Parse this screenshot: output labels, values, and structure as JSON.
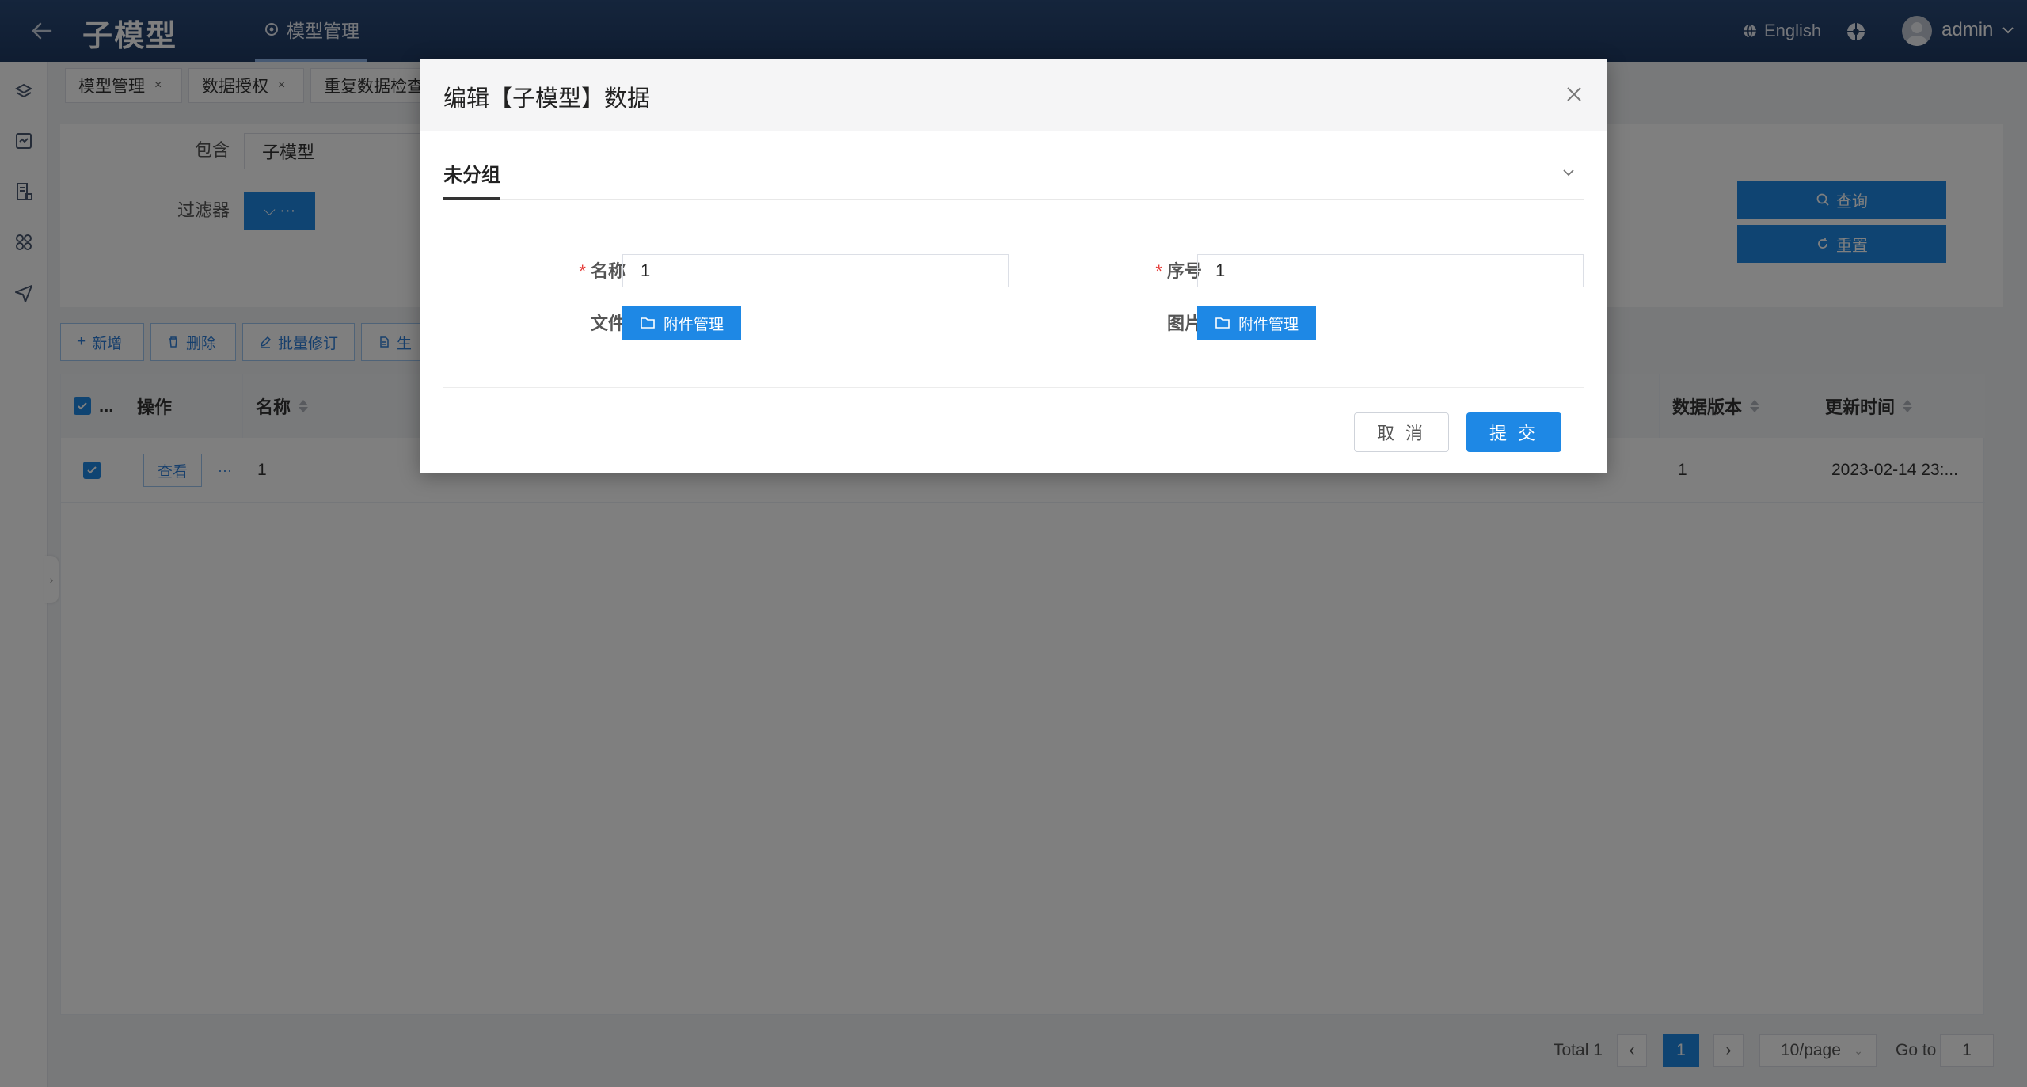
{
  "header": {
    "title": "子模型",
    "nav_label": "模型管理",
    "lang_label": "English",
    "user_name": "admin"
  },
  "tabs": [
    {
      "label": "模型管理",
      "close": "×"
    },
    {
      "label": "数据授权",
      "close": "×"
    },
    {
      "label": "重复数据检查"
    }
  ],
  "filter": {
    "contains_label": "包含",
    "contains_value": "子模型",
    "filter_label": "过滤器",
    "filter_button": "⌵ ···",
    "query_button": "查询",
    "reset_button": "重置"
  },
  "toolbar": {
    "add": "新增",
    "delete": "删除",
    "batch_edit": "批量修订",
    "generate": "生"
  },
  "table": {
    "headers": {
      "check": "...",
      "operation": "操作",
      "name": "名称",
      "data_version": "数据版本",
      "update_time": "更新时间"
    },
    "rows": [
      {
        "view": "查看",
        "more": "···",
        "name": "1",
        "data_version": "1",
        "update_time": "2023-02-14 23:..."
      }
    ]
  },
  "pagination": {
    "total": "Total 1",
    "current_page": "1",
    "page_size": "10/page",
    "goto_label": "Go to",
    "goto_value": "1"
  },
  "modal": {
    "title": "编辑【子模型】数据",
    "group": "未分组",
    "fields": {
      "name_label": "名称",
      "name_value": "1",
      "seq_label": "序号",
      "seq_value": "1",
      "required_mark": "*",
      "file_label": "文件",
      "image_label": "图片",
      "attach_button": "附件管理"
    },
    "cancel": "取 消",
    "submit": "提 交"
  },
  "colors": {
    "primary": "#1e88e5",
    "header": "#1f3a63",
    "required": "#e53935"
  }
}
